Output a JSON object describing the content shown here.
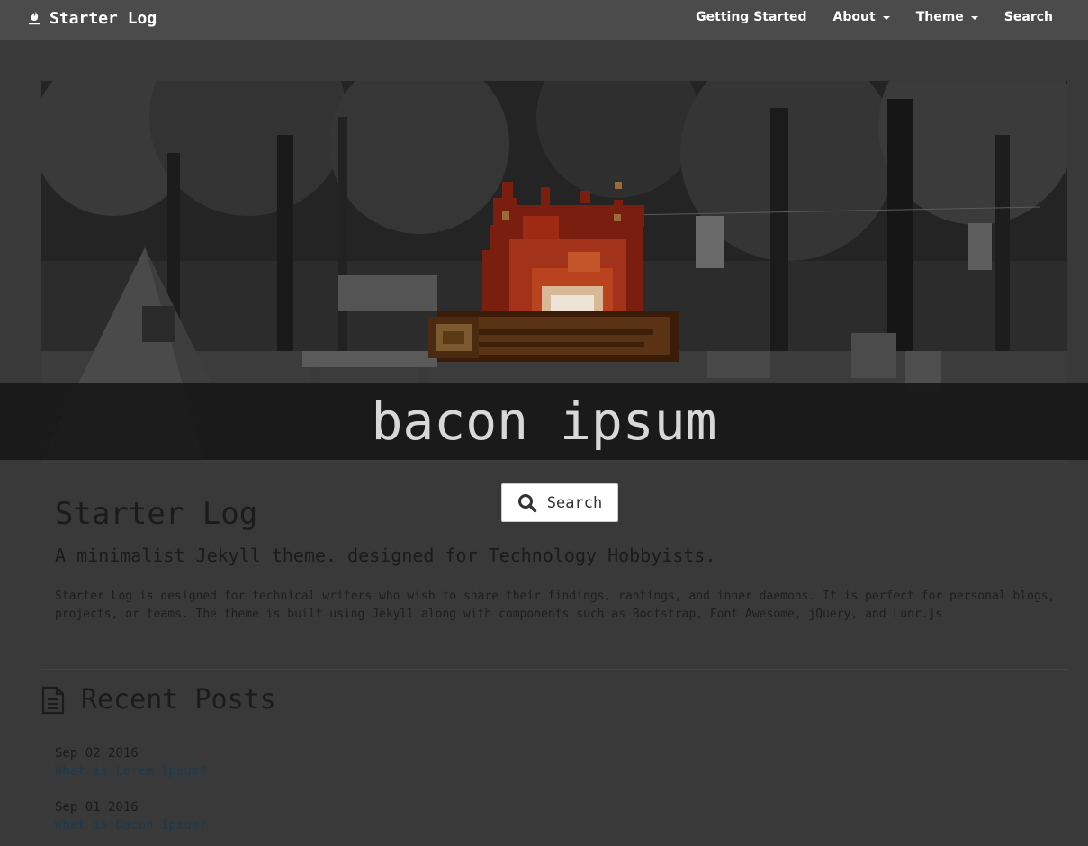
{
  "navbar": {
    "brand": "Starter Log",
    "brand_icon": "flame-icon",
    "links": [
      {
        "label": "Getting Started",
        "dropdown": false
      },
      {
        "label": "About",
        "dropdown": true
      },
      {
        "label": "Theme",
        "dropdown": true
      },
      {
        "label": "Search",
        "dropdown": false
      }
    ]
  },
  "hero": {
    "image": "campsite-photo-with-pixel-campfire"
  },
  "search": {
    "query": "bacon ipsum",
    "button_label": "Search",
    "button_icon": "search-icon"
  },
  "content": {
    "title": "Starter Log",
    "subtitle": "A minimalist Jekyll theme. designed for Technology Hobbyists.",
    "description": "Starter Log is designed for technical writers who wish to share their findings, rantings, and inner daemons. It is perfect for personal blogs, projects, or teams. The theme is built using Jekyll along with components such as Bootstrap, Font Awesome, jQuery, and Lunr.js"
  },
  "recent_posts": {
    "heading": "Recent Posts",
    "icon": "document-icon",
    "posts": [
      {
        "date": "Sep 02 2016",
        "title": "What is Lorem Ipsum?"
      },
      {
        "date": "Sep 01 2016",
        "title": "What is Bacon Ipsum?"
      }
    ]
  },
  "colors": {
    "page_background": "#393939",
    "navbar": "#4b4b4b",
    "overlay_band": "#161616",
    "link": "#1d3a4c",
    "flame_dark": "#7a1e10",
    "flame_mid": "#b8431e",
    "log_brown": "#5a3314"
  }
}
